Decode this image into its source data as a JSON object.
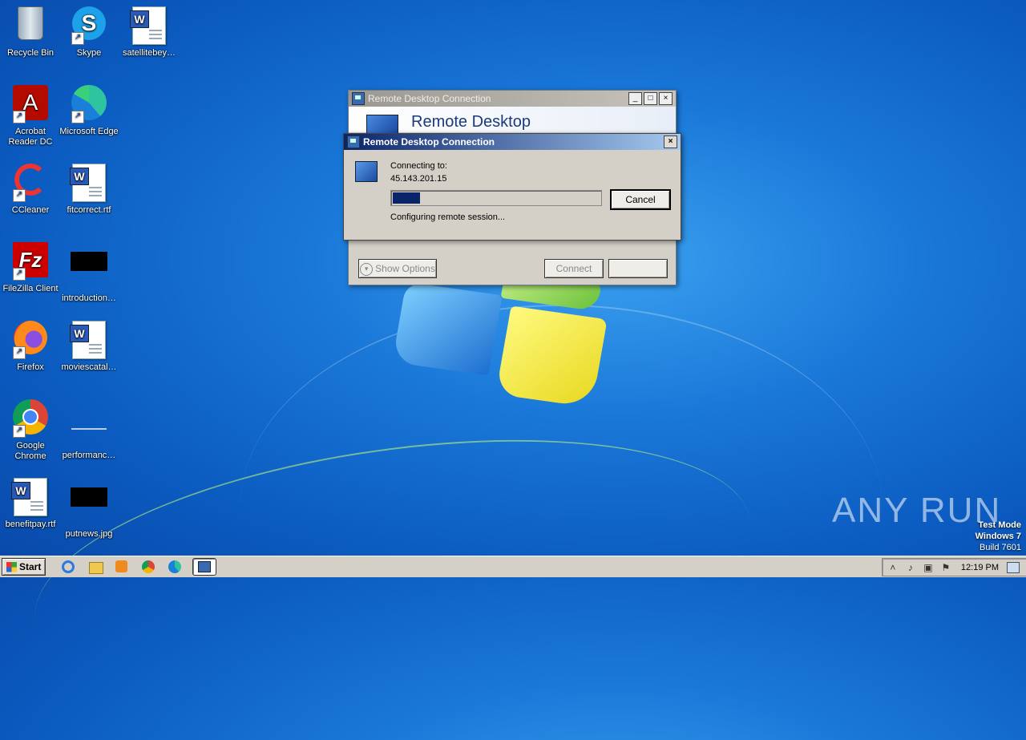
{
  "desktop": {
    "icons": [
      {
        "label": "Recycle Bin",
        "icon": "recycle-bin-icon"
      },
      {
        "label": "Skype",
        "icon": "skype-icon"
      },
      {
        "label": "satellitebey…",
        "icon": "word-document-icon"
      },
      {
        "label": "Acrobat Reader DC",
        "line1": "Acrobat",
        "line2": "Reader DC",
        "icon": "acrobat-icon"
      },
      {
        "label": "Microsoft Edge",
        "icon": "edge-icon"
      },
      {
        "label": "CCleaner",
        "icon": "ccleaner-icon"
      },
      {
        "label": "fitcorrect.rtf",
        "icon": "word-document-icon"
      },
      {
        "label": "FileZilla Client",
        "icon": "filezilla-icon"
      },
      {
        "label": "introduction…",
        "icon": "black-image-icon"
      },
      {
        "label": "Firefox",
        "icon": "firefox-icon"
      },
      {
        "label": "moviescatal…",
        "icon": "word-document-icon"
      },
      {
        "label": "Google Chrome",
        "line1": "Google",
        "line2": "Chrome",
        "icon": "chrome-icon"
      },
      {
        "label": "performanc…",
        "icon": "blank-image-icon"
      },
      {
        "label": "benefitpay.rtf",
        "icon": "word-document-icon"
      },
      {
        "label": "putnews.jpg",
        "icon": "black-image-icon"
      }
    ],
    "watermark": {
      "brand": "ANY RUN",
      "line1": "Test Mode",
      "line2": "Windows 7",
      "line3": "Build 7601"
    }
  },
  "back_window": {
    "title": "Remote Desktop Connection",
    "banner": "Remote Desktop",
    "show_options": "Show Options",
    "connect": "Connect",
    "minimize": "_",
    "maximize": "□",
    "close": "×"
  },
  "dialog": {
    "title": "Remote Desktop Connection",
    "close": "×",
    "connecting_label": "Connecting to:",
    "address": "45.143.201.15",
    "progress_fraction": 0.13,
    "cancel": "Cancel",
    "status": "Configuring remote session..."
  },
  "taskbar": {
    "start": "Start",
    "pinned": [
      "internet-explorer-icon",
      "explorer-icon",
      "media-player-icon",
      "chrome-icon",
      "edge-icon",
      "remote-desktop-icon"
    ],
    "clock": "12:19 PM",
    "colors": {
      "taskbar": "#d4d0c8",
      "accent": "#0a246a"
    }
  }
}
